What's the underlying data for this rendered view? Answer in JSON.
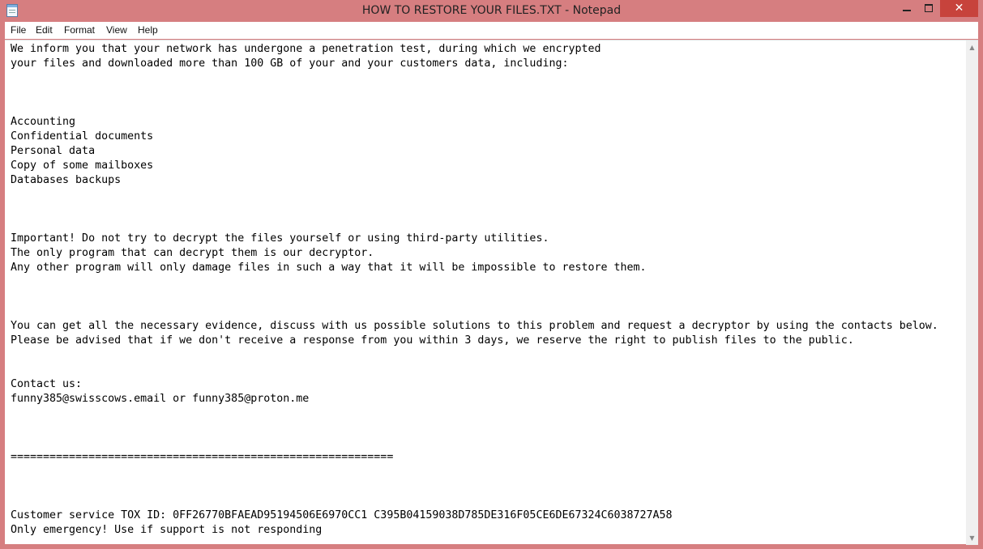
{
  "window": {
    "title": "HOW TO RESTORE YOUR FILES.TXT - Notepad",
    "close_label": "✕"
  },
  "menu": [
    "File",
    "Edit",
    "Format",
    "View",
    "Help"
  ],
  "editor": {
    "lines": [
      "We inform you that your network has undergone a penetration test, during which we encrypted",
      "your files and downloaded more than 100 GB of your and your customers data, including:",
      "",
      "",
      "",
      "Accounting",
      "Confidential documents",
      "Personal data",
      "Copy of some mailboxes",
      "Databases backups",
      "",
      "",
      "",
      "Important! Do not try to decrypt the files yourself or using third-party utilities.",
      "The only program that can decrypt them is our decryptor.",
      "Any other program will only damage files in such a way that it will be impossible to restore them.",
      "",
      "",
      "",
      "You can get all the necessary evidence, discuss with us possible solutions to this problem and request a decryptor by using the contacts below.",
      "Please be advised that if we don't receive a response from you within 3 days, we reserve the right to publish files to the public.",
      "",
      "",
      "Contact us:",
      "funny385@swisscows.email or funny385@proton.me",
      "",
      "",
      "",
      "===========================================================",
      "",
      "",
      "",
      "Customer service TOX ID: 0FF26770BFAEAD95194506E6970CC1 C395B04159038D785DE316F05CE6DE67324C6038727A58",
      "Only emergency! Use if support is not responding"
    ]
  },
  "scrollbar": {
    "up_arrow": "▲",
    "down_arrow": "▼"
  },
  "icons": {
    "app": "notepad-icon",
    "minimize": "minimize-icon",
    "maximize": "maximize-icon",
    "close": "close-icon"
  },
  "colors": {
    "frame": "#d67e80",
    "close_button": "#c7433c",
    "editor_bg": "#ffffff"
  }
}
